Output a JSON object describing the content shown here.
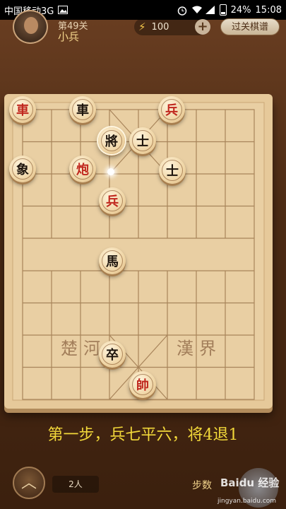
{
  "status_bar": {
    "carrier": "中国移动3G",
    "battery": "24%",
    "time": "15:08"
  },
  "header": {
    "level_text": "第49关",
    "player_name": "小兵",
    "energy": "100",
    "plus": "+",
    "level_button": "过关棋谱"
  },
  "board": {
    "river_left": "楚河",
    "river_right": "漢界",
    "pieces": [
      {
        "char": "車",
        "color": "red"
      },
      {
        "char": "車",
        "color": "black"
      },
      {
        "char": "兵",
        "color": "red"
      },
      {
        "char": "將",
        "color": "black"
      },
      {
        "char": "士",
        "color": "black"
      },
      {
        "char": "象",
        "color": "black"
      },
      {
        "char": "炮",
        "color": "red"
      },
      {
        "char": "士",
        "color": "black"
      },
      {
        "char": "兵",
        "color": "red"
      },
      {
        "char": "馬",
        "color": "black"
      },
      {
        "char": "卒",
        "color": "black"
      },
      {
        "char": "帥",
        "color": "red"
      }
    ]
  },
  "caption": "第一步，兵七平六，将4退1",
  "footer": {
    "home_icon": "chevron-up-icon",
    "players": "2人",
    "steps_label": "步数",
    "watermark_main": "Baidu 经验",
    "watermark_url": "jingyan.baidu.com"
  }
}
